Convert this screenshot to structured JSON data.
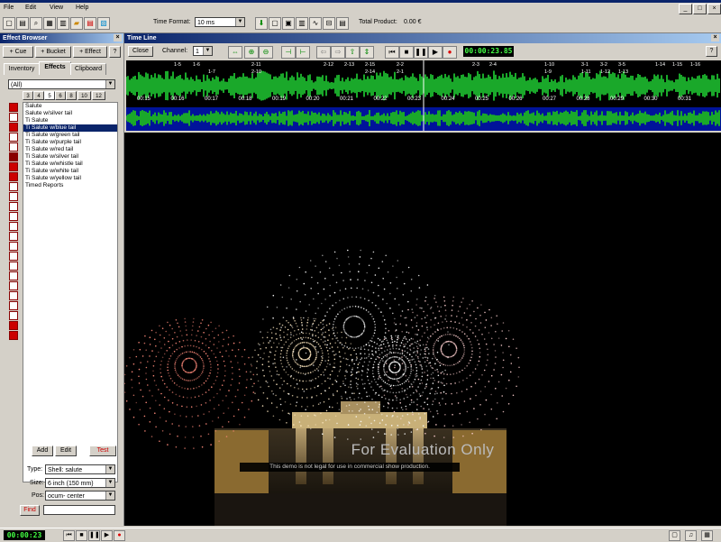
{
  "menu": [
    "File",
    "Edit",
    "View",
    "Help"
  ],
  "window_buttons": [
    "_",
    "□",
    "×"
  ],
  "toolbar": {
    "time_format_label": "Time Format:",
    "time_format_value": "10 ms",
    "total_product_label": "Total Product:",
    "total_product_value": "0.00 €"
  },
  "effect_browser": {
    "title": "Effect Browser",
    "close": "×",
    "buttons": [
      "+ Cue",
      "+ Bucket",
      "+ Effect",
      "?"
    ],
    "tabs": [
      "Inventory",
      "Effects",
      "Clipboard"
    ],
    "filter": "(All)",
    "size_buttons": [
      "3",
      "4",
      "5",
      "6",
      "8",
      "10",
      "12"
    ],
    "effects": [
      "Salute",
      "Salute w/silver tail",
      "Ti Salute",
      "Ti Salute w/blue tail",
      "Ti Salute w/green tail",
      "Ti Salute w/purple tail",
      "Ti Salute w/red tail",
      "Ti Salute w/silver tail",
      "Ti Salute w/whistle tail",
      "Ti Salute w/white tail",
      "Ti Salute w/yellow tail",
      "Timed Reports"
    ],
    "selected_index": 3,
    "actions": [
      "Add",
      "Edit",
      "Test"
    ],
    "type_label": "Type:",
    "type_value": "Shell: salute",
    "size_label": "Size:",
    "size_value": "6 inch (150 mm)",
    "pos_label": "Pos:",
    "pos_value": "ocum- center",
    "find_label": "Find"
  },
  "timeline": {
    "title": "Time Line",
    "close": "×",
    "close_btn": "Close",
    "channel_label": "Channel:",
    "channel_value": "1",
    "time": "00:00:23.85",
    "help": "?",
    "ticks": [
      "00:15",
      "00:16",
      "00:17",
      "00:18",
      "00:19",
      "00:20",
      "00:21",
      "00:22",
      "00:23",
      "00:24",
      "00:25",
      "00:26",
      "00:27",
      "00:28",
      "00:29",
      "00:30",
      "00:31"
    ],
    "cues_top": [
      "1-5",
      "1-6",
      "2-11",
      "2-12",
      "2-13",
      "2-15",
      "2-2",
      "2-3",
      "2-4",
      "1-10",
      "3-1",
      "3-2",
      "3-5",
      "1-14",
      "1-15",
      "1-16"
    ],
    "cues_bottom": [
      "1-7",
      "2-10",
      "2-14",
      "2-1",
      "1-9",
      "1-11",
      "1-12",
      "1-13"
    ]
  },
  "view": {
    "eval_title": "For Evaluation Only",
    "eval_sub": "This demo is not legal for use in commercial show production."
  },
  "bottom": {
    "time": "00:00:23"
  },
  "colors": {
    "wave": "#1aa82a",
    "timeline_bg": "#000000",
    "title_blue": "#0a246a",
    "time_green": "#44ff44"
  }
}
